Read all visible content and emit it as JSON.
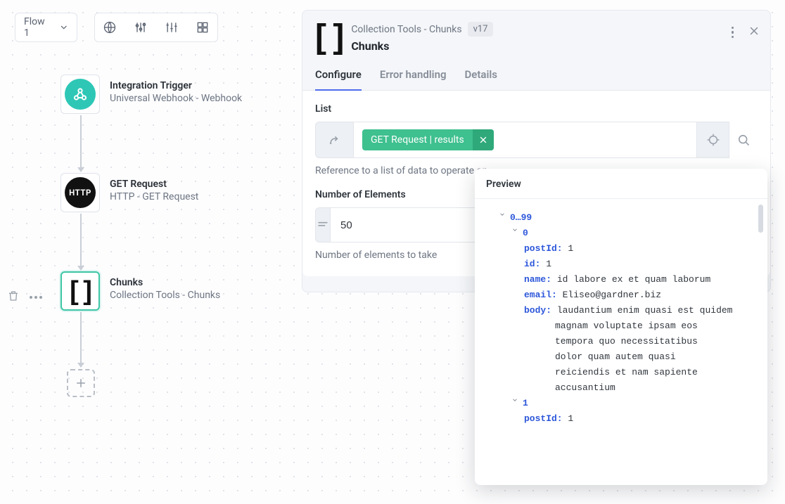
{
  "toolbar": {
    "flow_label": "Flow 1"
  },
  "nodes": {
    "trigger": {
      "title": "Integration Trigger",
      "subtitle": "Universal Webhook - Webhook"
    },
    "get": {
      "title": "GET Request",
      "subtitle": "HTTP - GET Request",
      "badge": "HTTP"
    },
    "chunks": {
      "title": "Chunks",
      "subtitle": "Collection Tools - Chunks"
    }
  },
  "panel": {
    "supertitle": "Collection Tools - Chunks",
    "version": "v17",
    "title": "Chunks",
    "tabs": {
      "configure": "Configure",
      "error": "Error handling",
      "details": "Details"
    },
    "list": {
      "label": "List",
      "chip": "GET Request | results",
      "help": "Reference to a list of data to operate on"
    },
    "num": {
      "label": "Number of Elements",
      "value": "50",
      "help": "Number of elements to take"
    }
  },
  "preview": {
    "title": "Preview",
    "range": "0…99",
    "entries": [
      {
        "idx": "0",
        "postId": "1",
        "id": "1",
        "name": "id labore ex et quam laborum",
        "email": "Eliseo@gardner.biz",
        "body_lines": [
          "laudantium enim quasi est quidem",
          "magnam voluptate ipsam eos",
          "tempora quo necessitatibus",
          "dolor quam autem quasi",
          "reiciendis et nam sapiente",
          "accusantium"
        ]
      },
      {
        "idx": "1",
        "postId": "1"
      }
    ],
    "keys": {
      "postId": "postId:",
      "id": "id:",
      "name": "name:",
      "email": "email:",
      "body": "body:"
    }
  }
}
